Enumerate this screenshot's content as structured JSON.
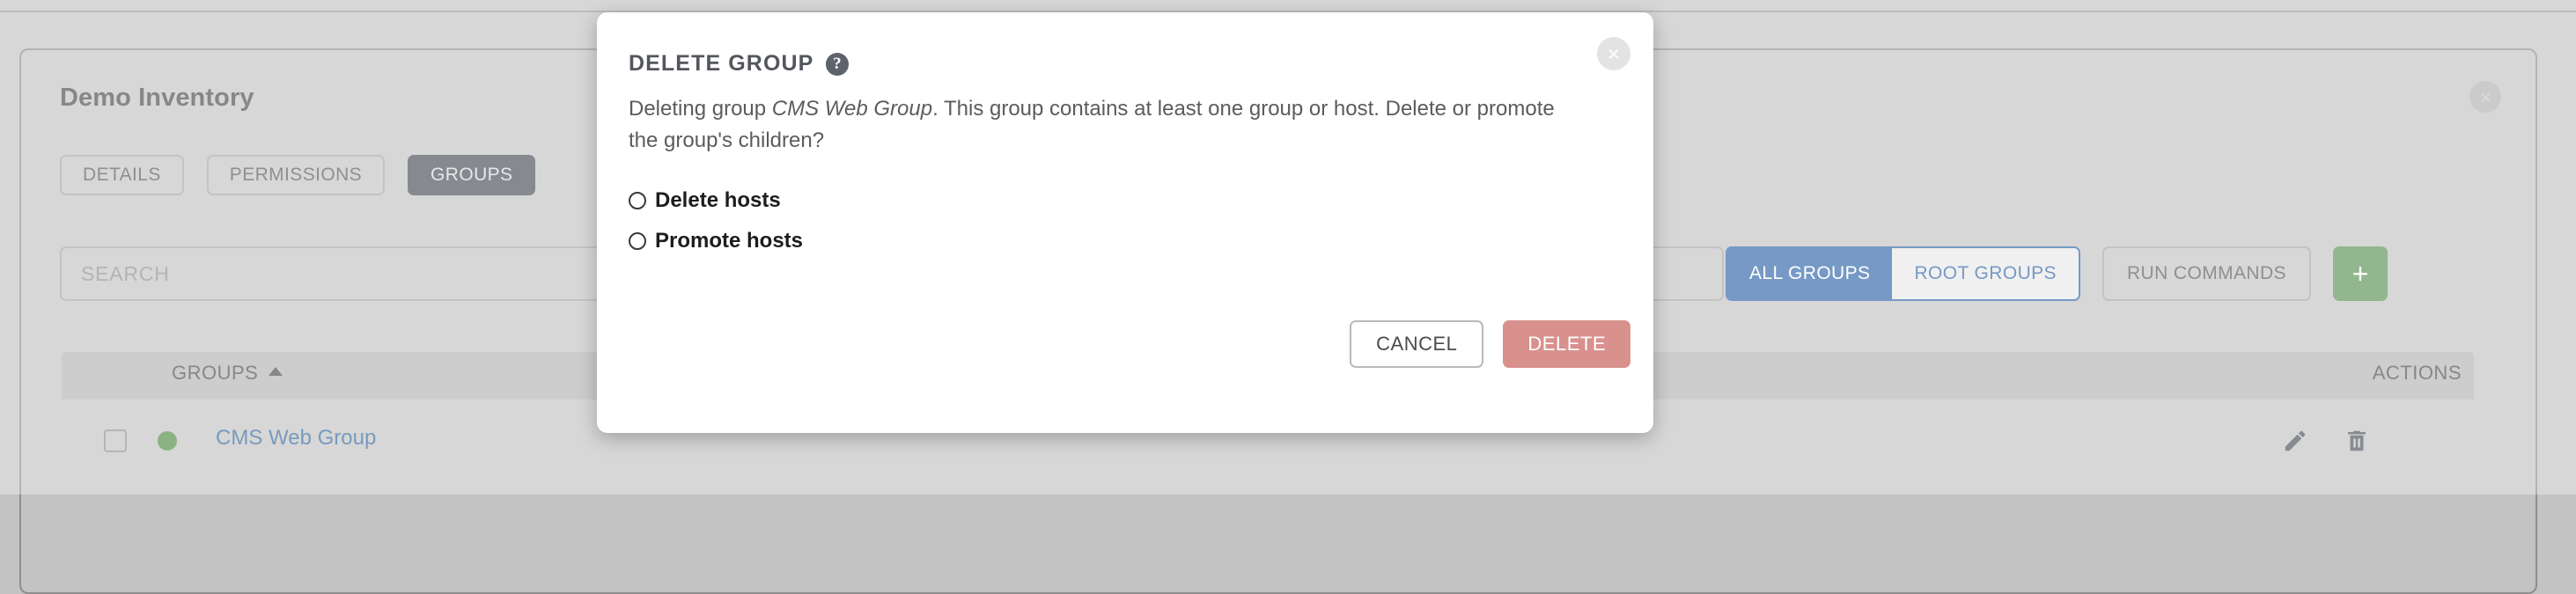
{
  "background": {
    "inventory_title": "Demo Inventory",
    "close_icon": "close-circle-icon",
    "tabs": [
      {
        "label": "DETAILS",
        "active": false
      },
      {
        "label": "PERMISSIONS",
        "active": false
      },
      {
        "label": "GROUPS",
        "active": true
      }
    ],
    "search": {
      "placeholder": "SEARCH",
      "value": ""
    },
    "controls": {
      "all_groups": "ALL GROUPS",
      "root_groups": "ROOT GROUPS",
      "run_commands": "RUN COMMANDS",
      "add_label": "+"
    },
    "table": {
      "col_groups": "GROUPS",
      "col_actions": "ACTIONS",
      "sort_direction": "ascending",
      "rows": [
        {
          "name": "CMS Web Group",
          "status": "active",
          "status_color": "#4f8b42",
          "checked": false,
          "edit_icon": "pencil-icon",
          "delete_icon": "trash-icon"
        }
      ]
    }
  },
  "modal": {
    "title": "DELETE GROUP",
    "help_icon": "question-mark-icon",
    "help_glyph": "?",
    "close_icon": "close-circle-icon",
    "body_prefix": "Deleting group ",
    "body_group_name": "CMS Web Group",
    "body_suffix": ". This group contains at least one group or host. Delete or promote the group's children?",
    "options": [
      {
        "label": "Delete hosts",
        "selected": false
      },
      {
        "label": "Promote hosts",
        "selected": false
      }
    ],
    "cancel_label": "CANCEL",
    "delete_label": "DELETE"
  },
  "colors": {
    "accent_blue": "#2f65a7",
    "danger": "#d9918d",
    "success_green": "#5a9152",
    "tab_active": "#484d57",
    "link": "#33679c"
  }
}
